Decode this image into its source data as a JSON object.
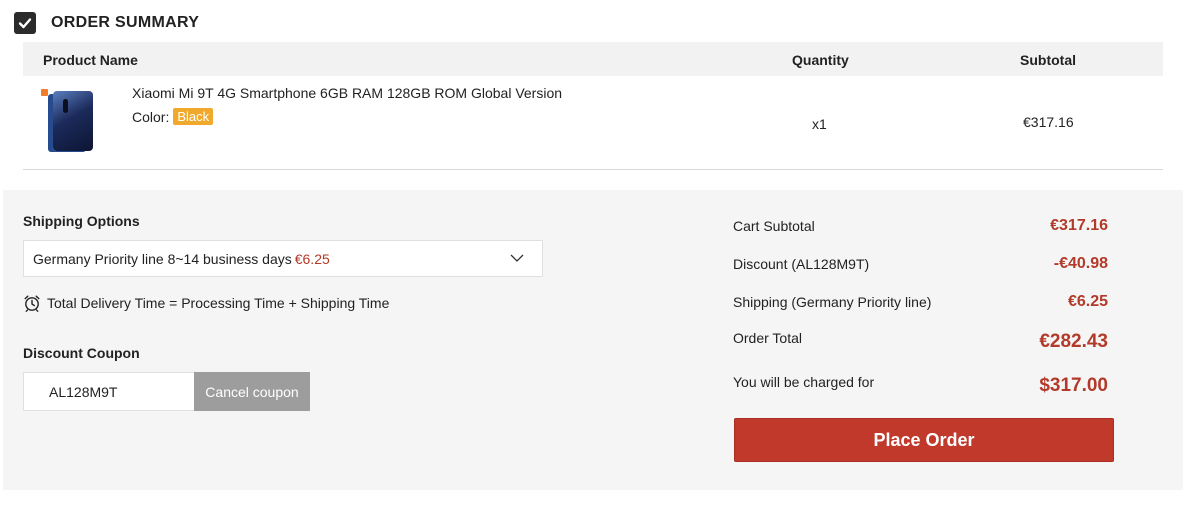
{
  "header": {
    "title": "ORDER SUMMARY"
  },
  "table": {
    "columns": {
      "name": "Product Name",
      "quantity": "Quantity",
      "subtotal": "Subtotal"
    },
    "rows": [
      {
        "name": "Xiaomi Mi 9T 4G Smartphone 6GB RAM 128GB ROM Global Version",
        "color_label": "Color:",
        "color_value": "Black",
        "quantity": "x1",
        "subtotal": "€317.16"
      }
    ]
  },
  "shipping": {
    "label": "Shipping Options",
    "selected_text": "Germany Priority line 8~14 business days",
    "selected_price": "€6.25",
    "delivery_note": "Total Delivery Time = Processing Time + Shipping Time"
  },
  "coupon": {
    "label": "Discount Coupon",
    "value": "AL128M9T",
    "cancel_label": "Cancel coupon"
  },
  "summary": {
    "cart_subtotal_label": "Cart Subtotal",
    "cart_subtotal": "€317.16",
    "discount_label": "Discount (AL128M9T)",
    "discount": "-€40.98",
    "shipping_label": "Shipping (Germany Priority line)",
    "shipping": "€6.25",
    "order_total_label": "Order Total",
    "order_total": "€282.43",
    "charged_label": "You will be charged for",
    "charged": "$317.00"
  },
  "place_order_label": "Place Order",
  "colors": {
    "accent": "#c0392b",
    "price": "#b23a2a",
    "badge": "#f0a92a"
  }
}
